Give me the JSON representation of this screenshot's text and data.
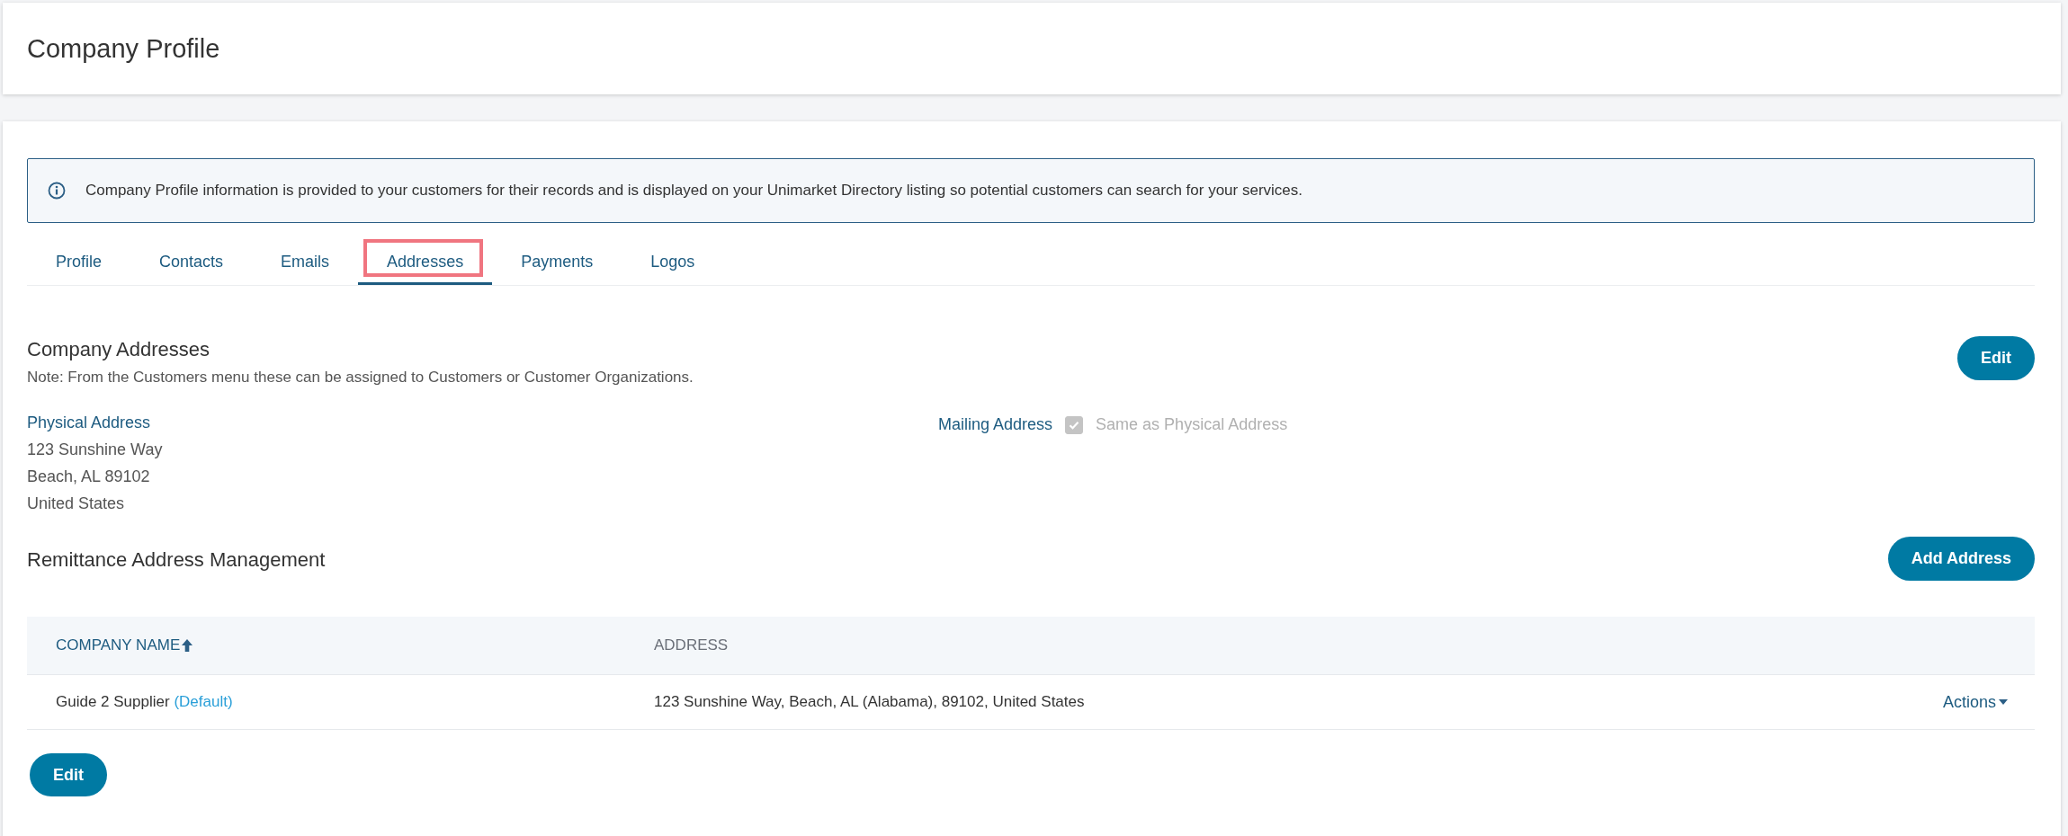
{
  "header": {
    "title": "Company Profile"
  },
  "info": {
    "text": "Company Profile information is provided to your customers for their records and is displayed on your Unimarket Directory listing so potential customers can search for your services."
  },
  "tabs": [
    {
      "label": "Profile",
      "selected": false,
      "highlighted": false
    },
    {
      "label": "Contacts",
      "selected": false,
      "highlighted": false
    },
    {
      "label": "Emails",
      "selected": false,
      "highlighted": false
    },
    {
      "label": "Addresses",
      "selected": true,
      "highlighted": true
    },
    {
      "label": "Payments",
      "selected": false,
      "highlighted": false
    },
    {
      "label": "Logos",
      "selected": false,
      "highlighted": false
    }
  ],
  "company_addresses": {
    "title": "Company Addresses",
    "note": "Note: From the Customers menu these can be assigned to Customers or Customer Organizations.",
    "edit_button": "Edit",
    "physical": {
      "label": "Physical Address",
      "lines": [
        "123 Sunshine Way",
        "Beach, AL 89102",
        "United States"
      ]
    },
    "mailing": {
      "label": "Mailing Address",
      "same_as_physical": {
        "label": "Same as Physical Address",
        "checked": true,
        "disabled": true
      }
    }
  },
  "remittance": {
    "title": "Remittance Address Management",
    "add_button": "Add Address",
    "table": {
      "columns": [
        {
          "label": "COMPANY NAME",
          "sorted": true
        },
        {
          "label": "ADDRESS",
          "sorted": false
        }
      ],
      "rows": [
        {
          "company": "Guide 2 Supplier",
          "tag": "(Default)",
          "address": "123 Sunshine Way, Beach, AL (Alabama), 89102, United States",
          "action": "Actions"
        }
      ]
    },
    "edit_button": "Edit"
  }
}
